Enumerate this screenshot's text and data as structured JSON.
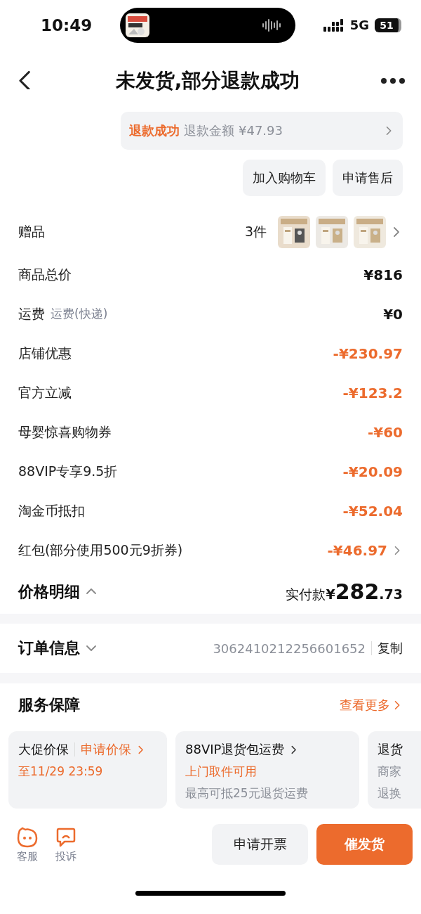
{
  "status_bar": {
    "time": "10:49",
    "network": "5G",
    "battery": "51"
  },
  "nav": {
    "title": "未发货,部分退款成功"
  },
  "refund": {
    "status": "退款成功",
    "label": "退款金额",
    "amount": "¥47.93"
  },
  "actions": [
    "加入购物车",
    "申请售后"
  ],
  "gift": {
    "label": "赠品",
    "count": "3件"
  },
  "price_rows": [
    {
      "label": "商品总价",
      "kind": "plain",
      "value": "¥816",
      "arrow": false
    },
    {
      "label": "运费",
      "note": "运费(快递)",
      "kind": "plain",
      "value": "¥0",
      "arrow": false
    },
    {
      "label": "店铺优惠",
      "kind": "discount",
      "value": "-¥230.97",
      "arrow": false
    },
    {
      "label": "官方立减",
      "kind": "discount",
      "value": "-¥123.2",
      "arrow": false
    },
    {
      "label": "母婴惊喜购物券",
      "kind": "discount",
      "value": "-¥60",
      "arrow": false
    },
    {
      "label": "88VIP专享9.5折",
      "kind": "discount",
      "value": "-¥20.09",
      "arrow": false
    },
    {
      "label": "淘金币抵扣",
      "kind": "discount",
      "value": "-¥52.04",
      "arrow": false
    },
    {
      "label": "红包(部分使用500元9折券)",
      "kind": "discount",
      "value": "-¥46.97",
      "arrow": true
    }
  ],
  "price_summary": {
    "label": "价格明细",
    "expanded": true,
    "paid_label": "实付款",
    "currency": "¥",
    "integer": "282",
    "decimal": ".73"
  },
  "order_info": {
    "label": "订单信息",
    "expanded": false,
    "number": "3062410212256601652",
    "copy": "复制"
  },
  "services": {
    "title": "服务保障",
    "more": "查看更多",
    "cards": [
      {
        "title": "大促价保",
        "link": "申请价保",
        "line1": "至11/29 23:59",
        "highlighted": true
      },
      {
        "title": "88VIP退货包运费",
        "line1": "上门取件可用",
        "highlighted": true,
        "line2": "最高可抵25元退货运费"
      },
      {
        "title": "退货",
        "line1": "商家",
        "highlighted": false,
        "line2": "退换"
      }
    ]
  },
  "bottom_bar": {
    "icons": [
      {
        "label": "客服",
        "kind": "face"
      },
      {
        "label": "投诉",
        "kind": "chat"
      }
    ],
    "buttons": [
      {
        "label": "申请开票",
        "kind": "secondary"
      },
      {
        "label": "催发货",
        "kind": "primary"
      }
    ]
  }
}
